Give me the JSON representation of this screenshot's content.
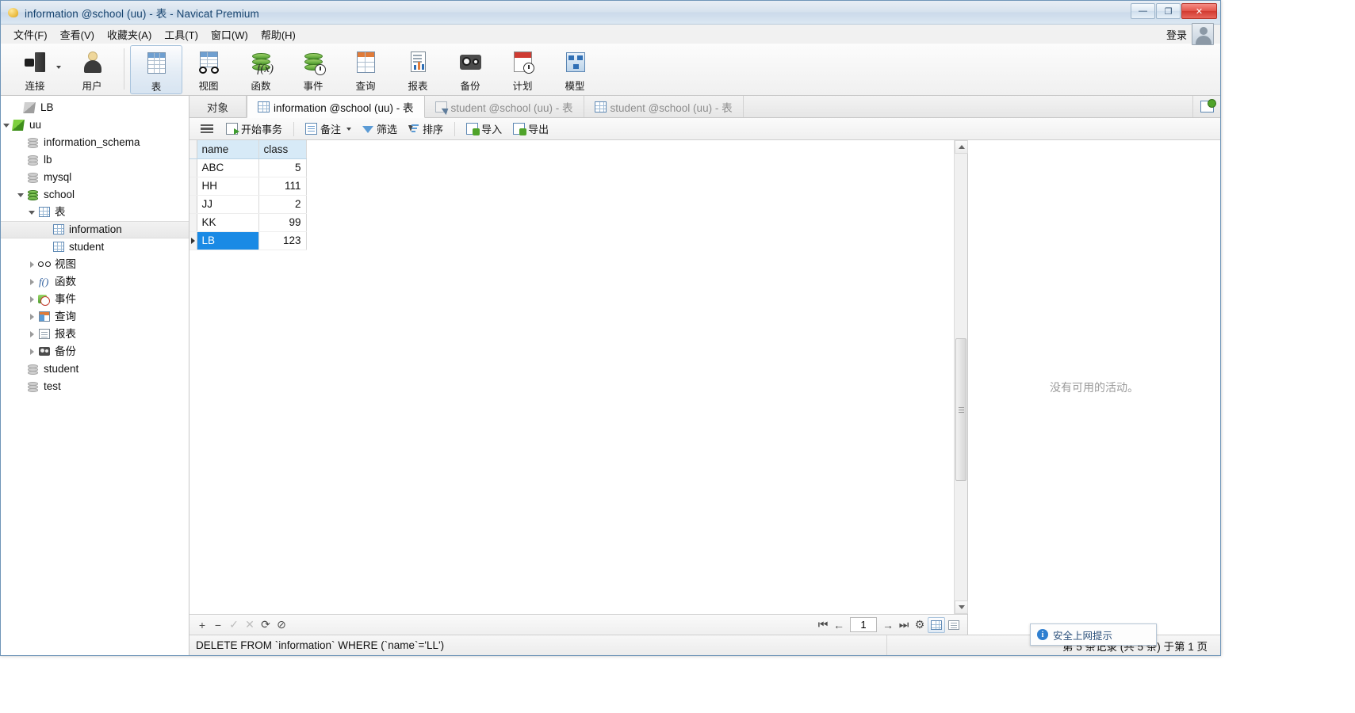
{
  "window": {
    "title": "information @school (uu) - 表 - Navicat Premium",
    "app_icon": "navicat-logo-icon",
    "minimize": "—",
    "maximize": "❐",
    "close": "✕"
  },
  "menubar": {
    "items": [
      {
        "label": "文件(F)"
      },
      {
        "label": "查看(V)"
      },
      {
        "label": "收藏夹(A)"
      },
      {
        "label": "工具(T)"
      },
      {
        "label": "窗口(W)"
      },
      {
        "label": "帮助(H)"
      }
    ],
    "login_label": "登录",
    "avatar": "user-avatar-icon"
  },
  "toolbar": {
    "buttons": [
      {
        "label": "连接",
        "icon": "connection-icon",
        "active": false,
        "has_dropdown": true
      },
      {
        "label": "用户",
        "icon": "user-icon",
        "active": false
      },
      {
        "label": "表",
        "icon": "table-icon",
        "active": true
      },
      {
        "label": "视图",
        "icon": "view-icon",
        "active": false
      },
      {
        "label": "函数",
        "icon": "function-icon",
        "active": false
      },
      {
        "label": "事件",
        "icon": "event-icon",
        "active": false
      },
      {
        "label": "查询",
        "icon": "query-icon",
        "active": false
      },
      {
        "label": "报表",
        "icon": "report-icon",
        "active": false
      },
      {
        "label": "备份",
        "icon": "backup-icon",
        "active": false
      },
      {
        "label": "计划",
        "icon": "schedule-icon",
        "active": false
      },
      {
        "label": "模型",
        "icon": "model-icon",
        "active": false
      }
    ]
  },
  "sidebar": {
    "items": [
      {
        "label": "LB",
        "icon": "connection-gray-icon",
        "indent": 1,
        "twisty": "none",
        "selected": false
      },
      {
        "label": "uu",
        "icon": "connection-green-icon",
        "indent": 1,
        "twisty": "open",
        "selected": false
      },
      {
        "label": "information_schema",
        "icon": "database-gray-icon",
        "indent": 2,
        "twisty": "none",
        "selected": false
      },
      {
        "label": "lb",
        "icon": "database-gray-icon",
        "indent": 2,
        "twisty": "none",
        "selected": false
      },
      {
        "label": "mysql",
        "icon": "database-gray-icon",
        "indent": 2,
        "twisty": "none",
        "selected": false
      },
      {
        "label": "school",
        "icon": "database-green-icon",
        "indent": 2,
        "twisty": "open",
        "selected": false
      },
      {
        "label": "表",
        "icon": "table-folder-icon",
        "indent": 3,
        "twisty": "open",
        "selected": false
      },
      {
        "label": "information",
        "icon": "table-icon",
        "indent": 4,
        "twisty": "none",
        "selected": true
      },
      {
        "label": "student",
        "icon": "table-icon",
        "indent": 4,
        "twisty": "none",
        "selected": false
      },
      {
        "label": "视图",
        "icon": "view-folder-icon",
        "indent": 3,
        "twisty": "closed",
        "selected": false
      },
      {
        "label": "函数",
        "icon": "function-folder-icon",
        "indent": 3,
        "twisty": "closed",
        "selected": false
      },
      {
        "label": "事件",
        "icon": "event-folder-icon",
        "indent": 3,
        "twisty": "closed",
        "selected": false
      },
      {
        "label": "查询",
        "icon": "query-folder-icon",
        "indent": 3,
        "twisty": "closed",
        "selected": false
      },
      {
        "label": "报表",
        "icon": "report-folder-icon",
        "indent": 3,
        "twisty": "closed",
        "selected": false
      },
      {
        "label": "备份",
        "icon": "backup-folder-icon",
        "indent": 3,
        "twisty": "closed",
        "selected": false
      },
      {
        "label": "student",
        "icon": "database-gray-icon",
        "indent": 2,
        "twisty": "none",
        "selected": false
      },
      {
        "label": "test",
        "icon": "database-gray-icon",
        "indent": 2,
        "twisty": "none",
        "selected": false
      }
    ]
  },
  "tabs": {
    "object_tab": "对象",
    "items": [
      {
        "label": "information @school (uu) - 表",
        "icon": "table-icon",
        "active": true
      },
      {
        "label": "student @school (uu) - 表",
        "icon": "query-editor-icon",
        "active": false
      },
      {
        "label": "student @school (uu) - 表",
        "icon": "table-icon",
        "active": false
      }
    ],
    "new_tab_icon": "new-table-icon"
  },
  "gridbar": {
    "menu_icon": "hamburger-menu-icon",
    "buttons": [
      {
        "label": "开始事务",
        "icon": "begin-transaction-icon",
        "dropdown": false
      },
      {
        "label": "备注",
        "icon": "note-icon",
        "dropdown": true
      },
      {
        "label": "筛选",
        "icon": "filter-icon",
        "dropdown": false
      },
      {
        "label": "排序",
        "icon": "sort-icon",
        "dropdown": false
      },
      {
        "label": "导入",
        "icon": "import-icon",
        "dropdown": false
      },
      {
        "label": "导出",
        "icon": "export-icon",
        "dropdown": false
      }
    ]
  },
  "grid": {
    "columns": [
      "name",
      "class"
    ],
    "rows": [
      {
        "name": "ABC",
        "class": "5",
        "selected": false
      },
      {
        "name": "HH",
        "class": "111",
        "selected": false
      },
      {
        "name": "JJ",
        "class": "2",
        "selected": false
      },
      {
        "name": "KK",
        "class": "99",
        "selected": false
      },
      {
        "name": "LB",
        "class": "123",
        "selected": true
      }
    ],
    "selected_column": "name"
  },
  "activity": {
    "empty_message": "没有可用的活动。"
  },
  "gridfooter": {
    "add_icon": "+",
    "remove_icon": "−",
    "confirm_icon": "✓",
    "cancel_icon": "✕",
    "refresh_icon": "⟳",
    "stop_icon": "⊘",
    "first_icon": "⏮",
    "prev_icon": "←",
    "page_value": "1",
    "next_icon": "→",
    "last_icon": "⏭",
    "settings_icon": "⚙",
    "grid_view_icon": "grid-view-icon",
    "form_view_icon": "form-view-icon"
  },
  "statusbar": {
    "sql_text": "DELETE FROM `information` WHERE (`name`='LL')",
    "record_info": "第 5 条记录 (共 5 条) 于第 1 页"
  },
  "toast": {
    "icon": "info-icon",
    "message": "安全上网提示"
  },
  "colors": {
    "accent": "#1a8ae5",
    "header_bg": "#d7eaf7",
    "title_text": "#16436e",
    "close_red": "#d23a30"
  }
}
